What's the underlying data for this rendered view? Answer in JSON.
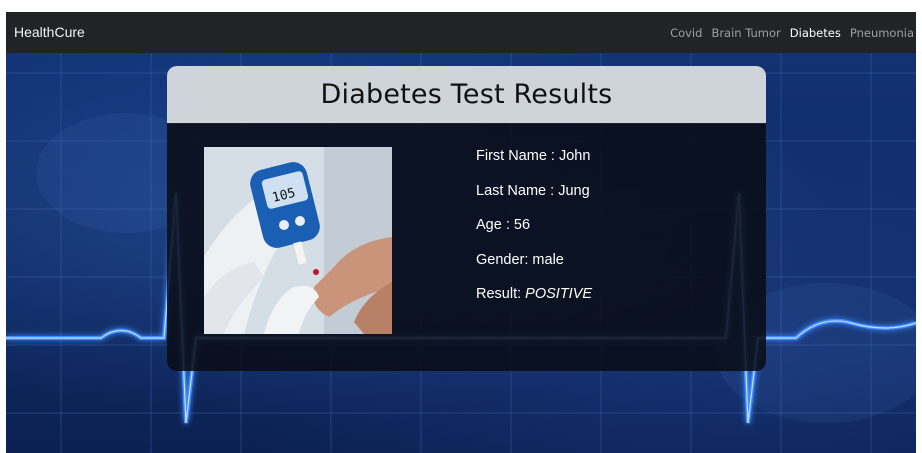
{
  "navbar": {
    "brand": "HealthCure",
    "links": [
      {
        "label": "Covid",
        "active": false
      },
      {
        "label": "Brain Tumor",
        "active": false
      },
      {
        "label": "Diabetes",
        "active": true
      },
      {
        "label": "Pneumonia",
        "active": false
      }
    ]
  },
  "card": {
    "title": "Diabetes Test Results",
    "image_text": "105",
    "fields": {
      "first_name": "First Name : John",
      "last_name": "Last Name : Jung",
      "age": "Age : 56",
      "gender": "Gender: male",
      "result_label": "Result: ",
      "result_value": "POSITIVE"
    }
  },
  "colors": {
    "navbar_bg": "#212427",
    "accent_wave": "#3f8cff",
    "card_header_bg": "#cfd3da"
  }
}
